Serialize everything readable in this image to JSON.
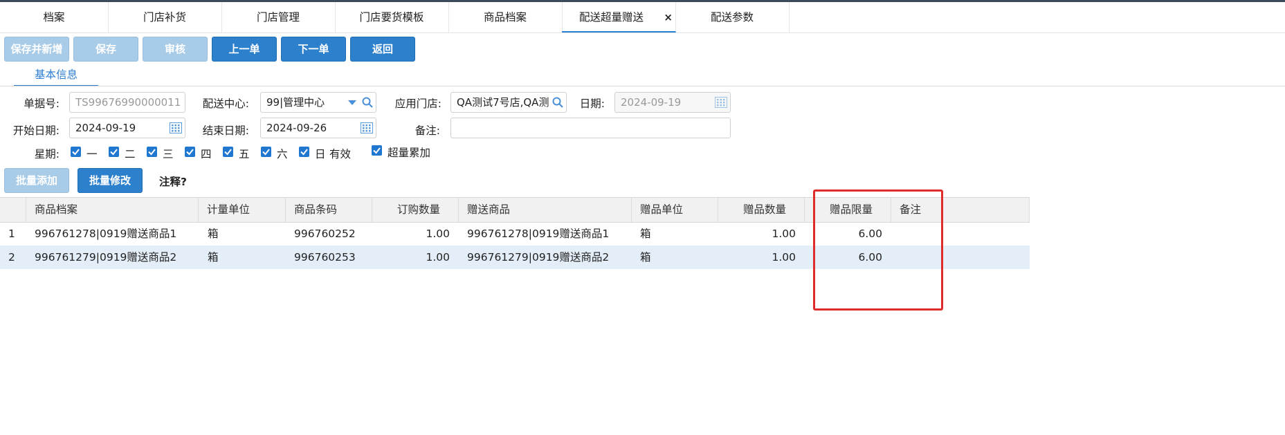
{
  "tabs": [
    {
      "label": "档案"
    },
    {
      "label": "门店补货"
    },
    {
      "label": "门店管理"
    },
    {
      "label": "门店要货模板"
    },
    {
      "label": "商品档案"
    },
    {
      "label": "配送超量赠送",
      "close": "×"
    },
    {
      "label": "配送参数"
    }
  ],
  "toolbar": {
    "save_new": "保存并新增",
    "save": "保存",
    "audit": "审核",
    "prev": "上一单",
    "next": "下一单",
    "back": "返回"
  },
  "subtab": {
    "label": "基本信息"
  },
  "form": {
    "doc_no_label": "单据号:",
    "doc_no_value": "TS99676990000011",
    "center_label": "配送中心:",
    "center_value": "99|管理中心",
    "store_label": "应用门店:",
    "store_value": "QA测试7号店,QA测",
    "date_label": "日期:",
    "date_value": "2024-09-19",
    "start_label": "开始日期:",
    "start_value": "2024-09-19",
    "end_label": "结束日期:",
    "end_value": "2024-09-26",
    "remark_label": "备注:",
    "remark_value": "",
    "week_label": "星期:",
    "weekdays": [
      "一",
      "二",
      "三",
      "四",
      "五",
      "六",
      "日"
    ],
    "valid_label": "有效",
    "excess_label": "超量累加"
  },
  "batch": {
    "add": "批量添加",
    "edit": "批量修改",
    "note": "注释?"
  },
  "grid": {
    "headers": [
      "商品档案",
      "计量单位",
      "商品条码",
      "订购数量",
      "赠送商品",
      "赠品单位",
      "赠品数量",
      "赠品限量",
      "备注"
    ],
    "rows": [
      {
        "idx": "1",
        "product": "996761278|0919赠送商品1",
        "unit": "箱",
        "barcode": "996760252",
        "qty": "1.00",
        "gift": "996761278|0919赠送商品1",
        "gift_unit": "箱",
        "gift_qty": "1.00",
        "limit": "6.00",
        "remark": ""
      },
      {
        "idx": "2",
        "product": "996761279|0919赠送商品2",
        "unit": "箱",
        "barcode": "996760253",
        "qty": "1.00",
        "gift": "996761279|0919赠送商品2",
        "gift_unit": "箱",
        "gift_qty": "1.00",
        "limit": "6.00",
        "remark": ""
      }
    ]
  },
  "colors": {
    "accent": "#2b7cd3",
    "button_enabled": "#2c80cc",
    "button_disabled": "#a8cbe8",
    "row_selected": "#e4eef8",
    "highlight_box": "#e02b2b"
  }
}
